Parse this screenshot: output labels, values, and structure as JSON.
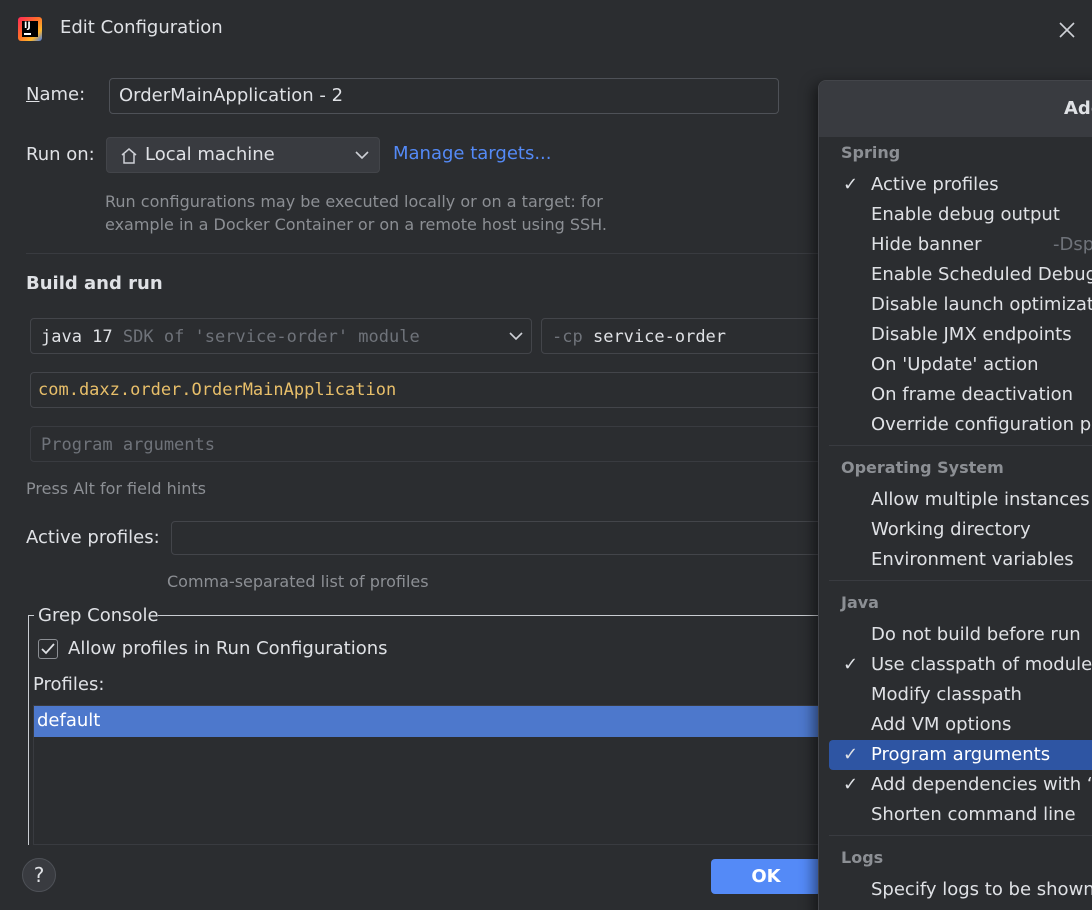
{
  "window": {
    "title": "Edit Configuration"
  },
  "form": {
    "name_label": "Name:",
    "name_value": "OrderMainApplication  - 2",
    "runon_label": "Run on:",
    "runon_value": "Local machine",
    "manage_targets": "Manage targets...",
    "runon_hint": "Run configurations may be executed locally or on a target: for example in a Docker Container or on a remote host using SSH.",
    "build_run_heading": "Build and run",
    "sdk_java": "java 17",
    "sdk_detail": "SDK of 'service-order' module",
    "cp_flag": "-cp",
    "cp_value": "service-order",
    "main_class": "com.daxz.order.OrderMainApplication",
    "program_args_placeholder": "Program arguments",
    "field_hints": "Press Alt for field hints",
    "active_profiles_label": "Active profiles:",
    "active_profiles_hint": "Comma-separated list of profiles"
  },
  "grep_console": {
    "title": "Grep Console",
    "allow_label": "Allow profiles in Run Configurations",
    "allow_checked": true,
    "profiles_label": "Profiles:",
    "profiles": [
      "default"
    ]
  },
  "footer": {
    "help": "?",
    "ok": "OK"
  },
  "popup": {
    "title": "Add",
    "spring_header": "Spring",
    "spring": [
      {
        "label": "Active profiles",
        "checked": "✓"
      },
      {
        "label": "Enable debug output",
        "checked": ""
      },
      {
        "label": "Hide banner",
        "checked": "",
        "extra": "-Dsp"
      },
      {
        "label": "Enable Scheduled Debugg",
        "checked": ""
      },
      {
        "label": "Disable launch optimizatio",
        "checked": ""
      },
      {
        "label": "Disable JMX endpoints",
        "checked": ""
      },
      {
        "label": "On 'Update' action",
        "checked": ""
      },
      {
        "label": "On frame deactivation",
        "checked": ""
      },
      {
        "label": "Override configuration pro",
        "checked": ""
      }
    ],
    "os_header": "Operating System",
    "os": [
      {
        "label": "Allow multiple instances",
        "checked": ""
      },
      {
        "label": "Working directory",
        "checked": ""
      },
      {
        "label": "Environment variables",
        "checked": ""
      }
    ],
    "java_header": "Java",
    "java": [
      {
        "label": "Do not build before run",
        "checked": ""
      },
      {
        "label": "Use classpath of module",
        "checked": "✓"
      },
      {
        "label": "Modify classpath",
        "checked": ""
      },
      {
        "label": "Add VM options",
        "checked": ""
      },
      {
        "label": "Program arguments",
        "checked": "✓"
      },
      {
        "label": "Add dependencies with “p",
        "checked": "✓"
      },
      {
        "label": "Shorten command line",
        "checked": ""
      }
    ],
    "logs_header": "Logs",
    "logs": [
      {
        "label": "Specify logs to be shown i",
        "checked": ""
      }
    ]
  }
}
